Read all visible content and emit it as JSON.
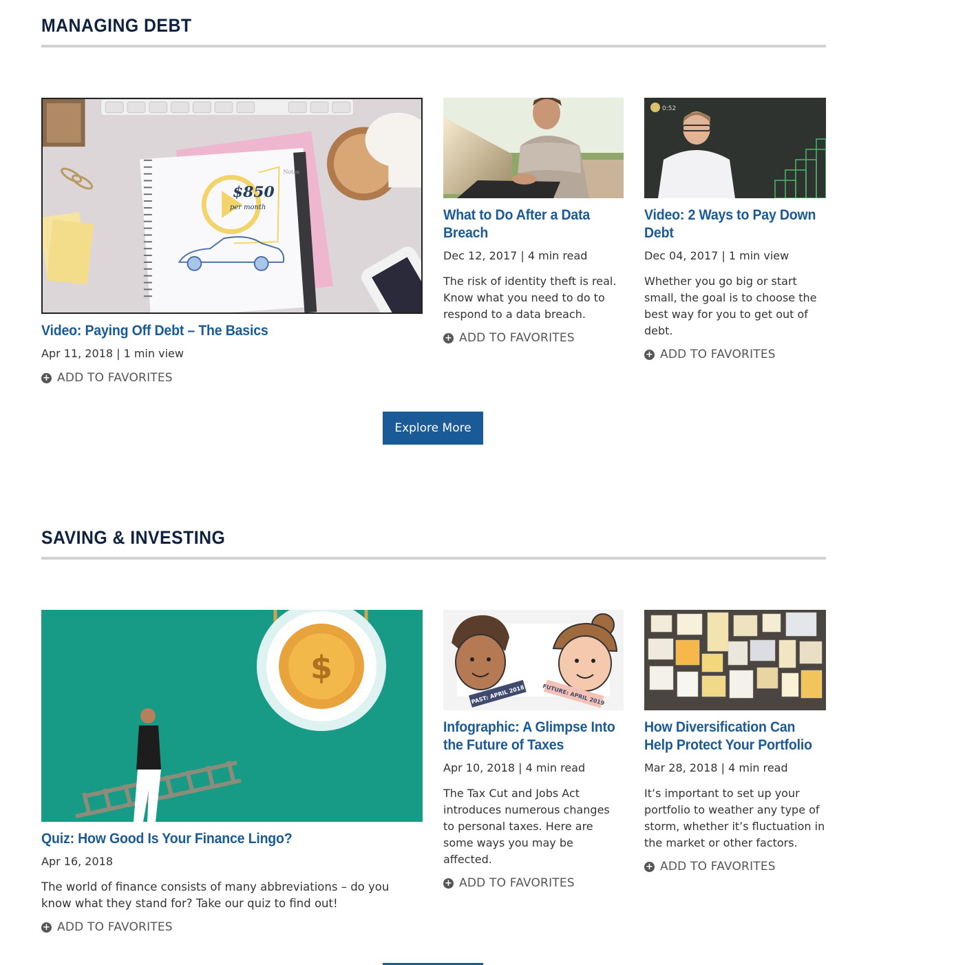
{
  "sections": [
    {
      "title": "MANAGING DEBT",
      "cards": [
        {
          "title": "Video: Paying Off Debt – The Basics",
          "meta": "Apr 11, 2018 | 1 min view",
          "description": "",
          "favorite_label": "ADD TO FAVORITES",
          "thumb_text": [
            "$850",
            "per month",
            "Notes"
          ]
        },
        {
          "title": "What to Do After a Data Breach",
          "meta": "Dec 12, 2017 | 4 min read",
          "description": "The risk of identity theft is real. Know what you need to do to respond to a data breach.",
          "favorite_label": "ADD TO FAVORITES"
        },
        {
          "title": "Video: 2 Ways to Pay Down Debt",
          "meta": "Dec 04, 2017 | 1 min view",
          "description": "Whether you go big or start small, the goal is to choose the best way for you to get out of debt.",
          "favorite_label": "ADD TO FAVORITES",
          "thumb_text": [
            "0:52"
          ]
        }
      ],
      "button_label": "Explore More"
    },
    {
      "title": "SAVING & INVESTING",
      "cards": [
        {
          "title": "Quiz: How Good Is Your Finance Lingo?",
          "meta": "Apr 16, 2018",
          "description": "The world of finance consists of many abbreviations – do you know what they stand for? Take our quiz to find out!",
          "favorite_label": "ADD TO FAVORITES",
          "thumb_text": [
            "$"
          ]
        },
        {
          "title": "Infographic: A Glimpse Into the Future of Taxes",
          "meta": "Apr 10, 2018 | 4 min read",
          "description": "The Tax Cut and Jobs Act introduces numerous changes to personal taxes. Here are some ways you may be affected.",
          "favorite_label": "ADD TO FAVORITES",
          "thumb_text": [
            "PAST: APRIL 2018",
            "FUTURE: APRIL 2019"
          ]
        },
        {
          "title": "How Diversification Can Help Protect Your Portfolio",
          "meta": "Mar 28, 2018 | 4 min read",
          "description": "It’s important to set up your portfolio to weather any type of storm, whether it’s fluctuation in the market or other factors.",
          "favorite_label": "ADD TO FAVORITES"
        }
      ]
    }
  ],
  "colors": {
    "heading": "#0e2240",
    "link": "#1a5a96",
    "button": "#1a5a96",
    "rule": "#d1d1d1",
    "teal": "#179a86"
  },
  "icons": [
    "plus-circle-icon",
    "play-icon",
    "stopwatch-icon",
    "dollar-coin-icon"
  ]
}
